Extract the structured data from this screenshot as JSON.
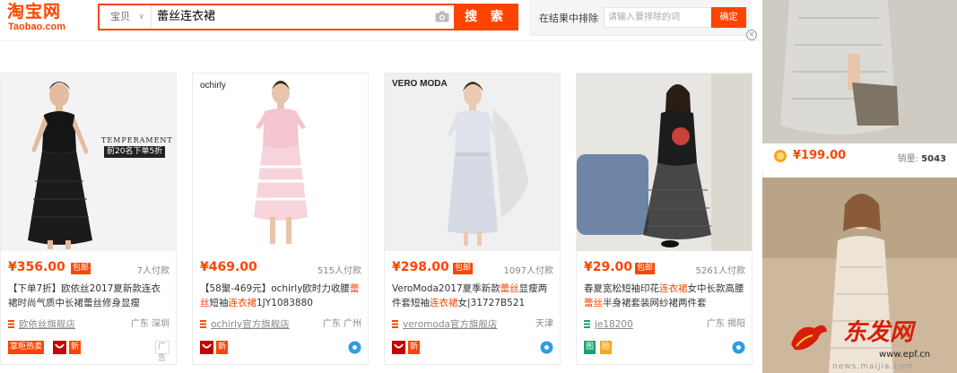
{
  "header": {
    "logo_cn": "淘宝网",
    "logo_en": "Taobao.com",
    "search_scope": "宝贝",
    "search_query": "蕾丝连衣裙",
    "search_button": "搜 索",
    "exclude_label": "在结果中排除",
    "exclude_placeholder": "请输入要排除的词",
    "exclude_button": "确定"
  },
  "colors": {
    "accent": "#ff4400",
    "price": "#ff4400",
    "muted": "#888888",
    "blue_badge": "#2a9ee4",
    "green_shop": "#1aa26a"
  },
  "products": [
    {
      "price": "¥356.00",
      "free_shipping": "包邮",
      "sales": "7人付款",
      "title": "【下单7折】欧依丝2017夏新款连衣裙时尚气质中长裙蕾丝修身显瘦",
      "shop": "欧依丝旗舰店",
      "location": "广东 深圳",
      "badges": [
        "掌柜热卖",
        "tmall-icon",
        "新"
      ],
      "ad_tag": "广告",
      "image_text": [
        "TEMPERAMENT",
        "前20名下单5折"
      ]
    },
    {
      "price": "¥469.00",
      "sales": "515人付款",
      "title_parts": [
        "【58聚-469元】ochirly欧时力收腰",
        "蕾丝",
        "短袖",
        "连衣裙",
        "1JY1083880"
      ],
      "shop": "ochirly官方旗舰店",
      "location": "广东 广州",
      "badges": [
        "tmall-icon",
        "新"
      ],
      "image_brand": "ochirly"
    },
    {
      "price": "¥298.00",
      "free_shipping": "包邮",
      "sales": "1097人付款",
      "title_parts": [
        "VeroModa2017夏季新款",
        "蕾丝",
        "显瘦两件套短袖",
        "连衣裙",
        "女|31727B521"
      ],
      "shop": "veromoda官方旗舰店",
      "location": "天津",
      "badges": [
        "tmall-icon",
        "新"
      ],
      "image_brand": "VERO MODA"
    },
    {
      "price": "¥29.00",
      "free_shipping": "包邮",
      "sales": "5261人付款",
      "title_parts": [
        "春夏宽松短袖印花",
        "连衣裙",
        "女中长款高腰",
        "蕾丝",
        "半身裙套装网纱裙两件套"
      ],
      "shop": "je18200",
      "location": "广东 揭阳",
      "badges": [
        "图",
        "险"
      ]
    }
  ],
  "ads": [
    {
      "price": "¥199.00",
      "sales_label": "销量:",
      "sales_value": "5043"
    }
  ],
  "watermark": {
    "text": "东发网",
    "url": "www.epf.cn",
    "sub": "news.maijia.com"
  }
}
